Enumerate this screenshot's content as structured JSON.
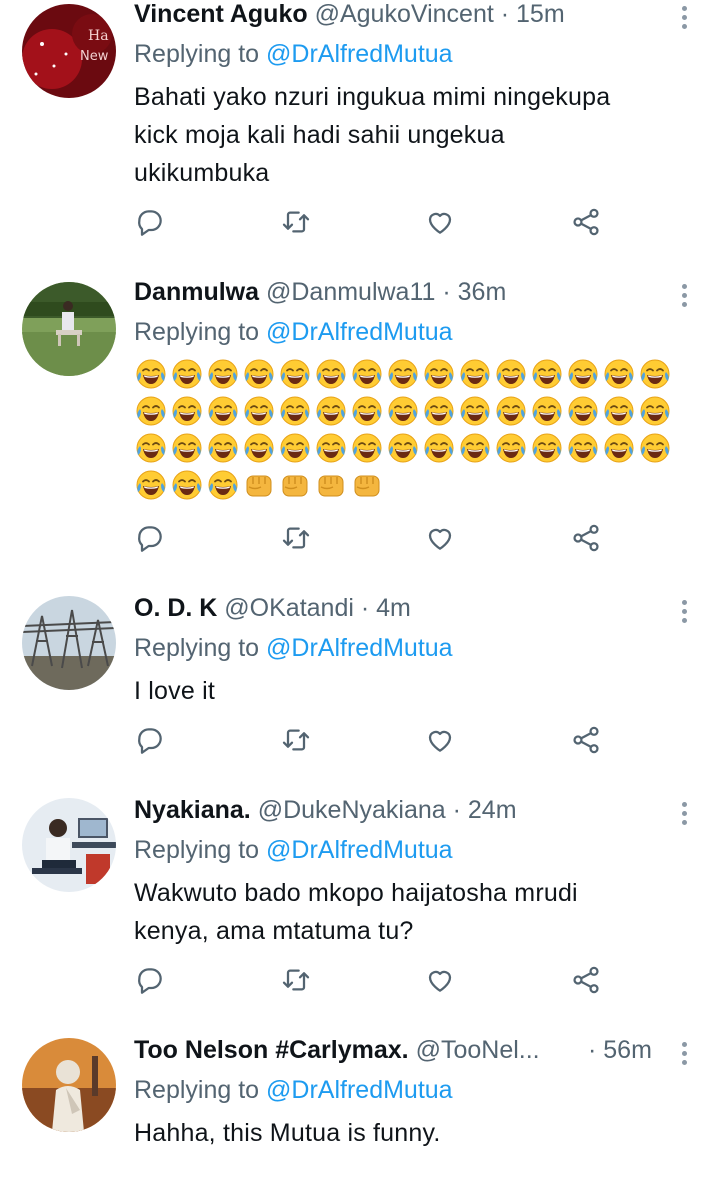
{
  "tweets": [
    {
      "name": "Vincent Aguko",
      "handle": "@AgukoVincent",
      "time": "· 15m",
      "reply_prefix": "Replying to",
      "reply_to": "@DrAlfredMutua",
      "text_lines": [
        "Bahati yako nzuri ingukua mimi ningekupa",
        "kick moja kali hadi sahii ungekua",
        "ukikumbuka"
      ],
      "avatar_text": [
        "Ha",
        "New"
      ]
    },
    {
      "name": "Danmulwa",
      "handle": "@Danmulwa11",
      "time": "· 36m",
      "reply_prefix": "Replying to",
      "reply_to": "@DrAlfredMutua",
      "emoji_rows": [
        {
          "laugh": 15,
          "fist": 0
        },
        {
          "laugh": 15,
          "fist": 0
        },
        {
          "laugh": 15,
          "fist": 0
        },
        {
          "laugh": 3,
          "fist": 4
        }
      ],
      "emoji_names": {
        "laugh": "face-with-tears-of-joy",
        "fist": "oncoming-fist"
      }
    },
    {
      "name": "O. D. K",
      "handle": "@OKatandi",
      "time": "· 4m",
      "reply_prefix": "Replying to",
      "reply_to": "@DrAlfredMutua",
      "text_lines": [
        "I love it"
      ]
    },
    {
      "name": "Nyakiana.",
      "handle": "@DukeNyakiana",
      "time": "· 24m",
      "reply_prefix": "Replying to",
      "reply_to": "@DrAlfredMutua",
      "text_lines": [
        "Wakwuto bado mkopo haijatosha mrudi",
        "kenya, ama mtatuma tu?"
      ]
    },
    {
      "name": "Too Nelson #Carlymax.",
      "handle": "@TooNel...",
      "time": "· 56m",
      "reply_prefix": "Replying to",
      "reply_to": "@DrAlfredMutua",
      "text_lines": [
        "Hahha, this Mutua is funny."
      ]
    }
  ],
  "action_icons": [
    "reply-icon",
    "retweet-icon",
    "like-icon",
    "share-icon"
  ],
  "colors": {
    "link": "#1d9bf0",
    "secondary": "#536471",
    "icon": "#536471",
    "divider": "#e1e6ea"
  }
}
